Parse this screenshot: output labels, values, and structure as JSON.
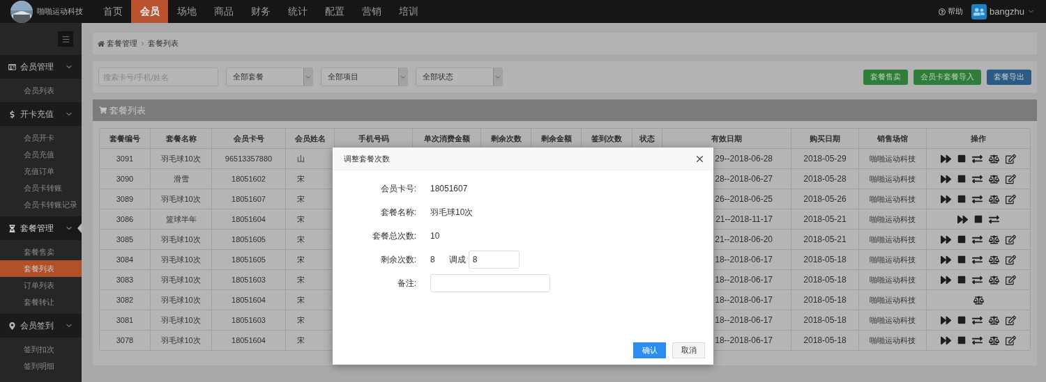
{
  "brand": {
    "name": "啪啪运动科技"
  },
  "nav": [
    {
      "label": "首页",
      "selected": false
    },
    {
      "label": "会员",
      "selected": true
    },
    {
      "label": "场地",
      "selected": false
    },
    {
      "label": "商品",
      "selected": false
    },
    {
      "label": "财务",
      "selected": false
    },
    {
      "label": "统计",
      "selected": false
    },
    {
      "label": "配置",
      "selected": false
    },
    {
      "label": "营销",
      "selected": false
    },
    {
      "label": "培训",
      "selected": false
    }
  ],
  "header_right": {
    "help": "帮助",
    "user": "bangzhu"
  },
  "sidebar": {
    "groups": [
      {
        "label": "会员管理",
        "expanded": true,
        "selected": false,
        "items": [
          {
            "label": "会员列表",
            "selected": false
          }
        ]
      },
      {
        "label": "开卡充值",
        "expanded": true,
        "selected": false,
        "items": [
          {
            "label": "会员开卡",
            "selected": false
          },
          {
            "label": "会员充值",
            "selected": false
          },
          {
            "label": "充值订单",
            "selected": false
          },
          {
            "label": "会员卡转账",
            "selected": false
          },
          {
            "label": "会员卡转账记录",
            "selected": false
          }
        ]
      },
      {
        "label": "套餐管理",
        "expanded": true,
        "selected": true,
        "items": [
          {
            "label": "套餐售卖",
            "selected": false
          },
          {
            "label": "套餐列表",
            "selected": true
          },
          {
            "label": "订单列表",
            "selected": false
          },
          {
            "label": "套餐转让",
            "selected": false
          }
        ]
      },
      {
        "label": "会员签到",
        "expanded": true,
        "selected": false,
        "items": [
          {
            "label": "签到扣次",
            "selected": false
          },
          {
            "label": "签到明细",
            "selected": false
          }
        ]
      }
    ]
  },
  "breadcrumb": [
    "套餐管理",
    "套餐列表"
  ],
  "filters": {
    "search": {
      "placeholder": "搜索卡号/手机/姓名"
    },
    "selects": [
      "全部套餐",
      "全部项目",
      "全部状态"
    ]
  },
  "actions": [
    {
      "label": "套餐售卖",
      "kind": "success"
    },
    {
      "label": "会员卡套餐导入",
      "kind": "success"
    },
    {
      "label": "套餐导出",
      "kind": "primary"
    }
  ],
  "table": {
    "title": "套餐列表",
    "columns": [
      "套餐编号",
      "套餐名称",
      "会员卡号",
      "会员姓名",
      "手机号码",
      "单次消费金额",
      "剩余次数",
      "剩余金额",
      "签到次数",
      "状态",
      "有效日期",
      "购买日期",
      "销售场馆",
      "操作"
    ],
    "rows": [
      {
        "id": "3091",
        "package": "羽毛球10次",
        "card": "96513357880",
        "member": "山",
        "valid": "29--2018-06-28",
        "purchased": "2018-05-29",
        "venue": "啪啪运动科技",
        "ops": [
          {
            "kind": "forward"
          },
          {
            "kind": "stop"
          },
          {
            "kind": "swap"
          },
          {
            "kind": "scale"
          },
          {
            "kind": "edit"
          }
        ]
      },
      {
        "id": "3090",
        "package": "滑雪",
        "card": "18051602",
        "member": "宋",
        "valid": "28--2018-06-27",
        "purchased": "2018-05-28",
        "venue": "啪啪运动科技",
        "ops": [
          {
            "kind": "forward"
          },
          {
            "kind": "stop"
          },
          {
            "kind": "swap"
          },
          {
            "kind": "scale"
          },
          {
            "kind": "edit"
          }
        ]
      },
      {
        "id": "3089",
        "package": "羽毛球10次",
        "card": "18051607",
        "member": "宋",
        "valid": "26--2018-06-25",
        "purchased": "2018-05-26",
        "venue": "啪啪运动科技",
        "ops": [
          {
            "kind": "forward"
          },
          {
            "kind": "stop"
          },
          {
            "kind": "swap"
          },
          {
            "kind": "scale"
          },
          {
            "kind": "edit"
          }
        ]
      },
      {
        "id": "3086",
        "package": "篮球半年",
        "card": "18051604",
        "member": "宋",
        "valid": "21--2018-11-17",
        "purchased": "2018-05-21",
        "venue": "啪啪运动科技",
        "ops": [
          {
            "kind": "forward"
          },
          {
            "kind": "stop"
          },
          {
            "kind": "swap"
          }
        ]
      },
      {
        "id": "3085",
        "package": "羽毛球10次",
        "card": "18051605",
        "member": "宋",
        "valid": "21--2018-06-20",
        "purchased": "2018-05-21",
        "venue": "啪啪运动科技",
        "ops": [
          {
            "kind": "forward"
          },
          {
            "kind": "stop"
          },
          {
            "kind": "swap"
          },
          {
            "kind": "scale"
          },
          {
            "kind": "edit"
          }
        ]
      },
      {
        "id": "3084",
        "package": "羽毛球10次",
        "card": "18051605",
        "member": "宋",
        "valid": "18--2018-06-17",
        "purchased": "2018-05-18",
        "venue": "啪啪运动科技",
        "ops": [
          {
            "kind": "forward"
          },
          {
            "kind": "stop"
          },
          {
            "kind": "swap"
          },
          {
            "kind": "scale"
          },
          {
            "kind": "edit"
          }
        ]
      },
      {
        "id": "3083",
        "package": "羽毛球10次",
        "card": "18051603",
        "member": "宋",
        "valid": "18--2018-06-17",
        "purchased": "2018-05-18",
        "venue": "啪啪运动科技",
        "ops": [
          {
            "kind": "forward"
          },
          {
            "kind": "stop"
          },
          {
            "kind": "swap"
          },
          {
            "kind": "scale"
          },
          {
            "kind": "edit"
          }
        ]
      },
      {
        "id": "3082",
        "package": "羽毛球10次",
        "card": "18051604",
        "member": "宋",
        "valid": "18--2018-06-17",
        "purchased": "2018-05-18",
        "venue": "啪啪运动科技",
        "ops": [
          {
            "kind": "scale"
          }
        ]
      },
      {
        "id": "3081",
        "package": "羽毛球10次",
        "card": "18051603",
        "member": "宋",
        "valid": "18--2018-06-17",
        "purchased": "2018-05-18",
        "venue": "啪啪运动科技",
        "ops": [
          {
            "kind": "forward"
          },
          {
            "kind": "stop"
          },
          {
            "kind": "swap"
          },
          {
            "kind": "scale"
          },
          {
            "kind": "edit"
          }
        ]
      },
      {
        "id": "3078",
        "package": "羽毛球10次",
        "card": "18051604",
        "member": "宋",
        "valid": "18--2018-06-17",
        "purchased": "2018-05-18",
        "venue": "啪啪运动科技",
        "ops": [
          {
            "kind": "forward"
          },
          {
            "kind": "stop"
          },
          {
            "kind": "swap"
          },
          {
            "kind": "scale"
          },
          {
            "kind": "edit"
          }
        ]
      }
    ]
  },
  "modal": {
    "title": "调整套餐次数",
    "fields": [
      {
        "kind": "text",
        "label": "会员卡号:",
        "value": "18051607"
      },
      {
        "kind": "text",
        "label": "套餐名称:",
        "value": "羽毛球10次"
      },
      {
        "kind": "text",
        "label": "套餐总次数:",
        "value": "10"
      },
      {
        "kind": "adjust",
        "label": "剩余次数:",
        "value": "8",
        "adjust_label": "调成",
        "input_value": "8"
      },
      {
        "kind": "input",
        "label": "备注:"
      }
    ],
    "buttons": [
      {
        "label": "确认",
        "kind": "primary"
      },
      {
        "label": "取消",
        "kind": "default"
      }
    ]
  }
}
